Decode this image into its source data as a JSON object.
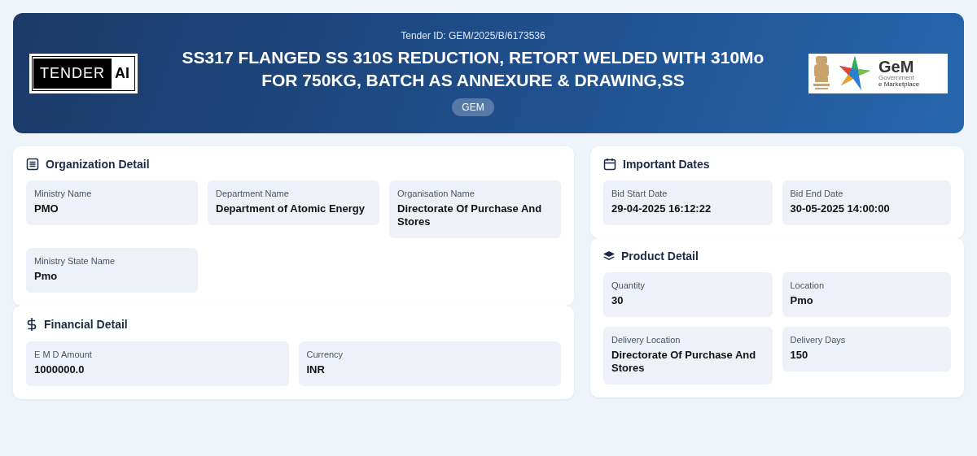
{
  "header": {
    "tender_id": "Tender ID: GEM/2025/B/6173536",
    "title": "SS317 FLANGED SS 310S REDUCTION, RETORT WELDED WITH 310Mo FOR 750KG, BATCH AS ANNEXURE & DRAWING,SS",
    "badge": "GEM",
    "left_logo": {
      "word": "TENDER",
      "mark": "AI"
    },
    "right_logo": {
      "name": "GeM",
      "line_1": "Government",
      "line_2": "e Marketplace"
    }
  },
  "columns": [
    {
      "sections": [
        {
          "title": "Organization Detail",
          "fields": [
            {
              "label": "Ministry Name",
              "value": "PMO"
            },
            {
              "label": "Department Name",
              "value": "Department of Atomic Energy"
            },
            {
              "label": "Organisation Name",
              "value": "Directorate Of Purchase And Stores"
            },
            {
              "label": "Ministry State Name",
              "value": "Pmo"
            }
          ]
        },
        {
          "title": "Financial Detail",
          "fields": [
            {
              "label": "E M D Amount",
              "value": "1000000.0"
            },
            {
              "label": "Currency",
              "value": "INR"
            }
          ]
        }
      ]
    },
    {
      "sections": [
        {
          "title": "Important Dates",
          "fields": [
            {
              "label": "Bid Start Date",
              "value": "29-04-2025 16:12:22"
            },
            {
              "label": "Bid End Date",
              "value": "30-05-2025 14:00:00"
            }
          ]
        },
        {
          "title": "Product Detail",
          "fields": [
            {
              "label": "Quantity",
              "value": "30"
            },
            {
              "label": "Location",
              "value": "Pmo"
            },
            {
              "label": "Delivery Location",
              "value": "Directorate Of Purchase And Stores"
            },
            {
              "label": "Delivery Days",
              "value": "150"
            }
          ]
        }
      ]
    }
  ]
}
